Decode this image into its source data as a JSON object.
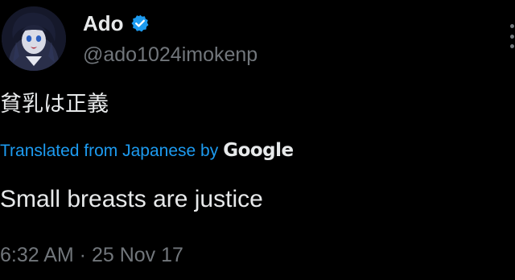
{
  "author": {
    "display_name": "Ado",
    "handle": "@ado1024imokenp",
    "verified": true,
    "verified_color": "#1d9bf0"
  },
  "tweet": {
    "text": "貧乳は正義",
    "translation_label": "Translated from Japanese by",
    "translation_provider": "Google",
    "translated_text": "Small breasts are justice",
    "timestamp": "6:32 AM · 25 Nov 17"
  },
  "icons": {
    "verified": "verified-badge-icon",
    "more": "more-options-icon"
  },
  "colors": {
    "background": "#000000",
    "text": "#e7e9ea",
    "secondary": "#71767b",
    "accent": "#1d9bf0"
  }
}
